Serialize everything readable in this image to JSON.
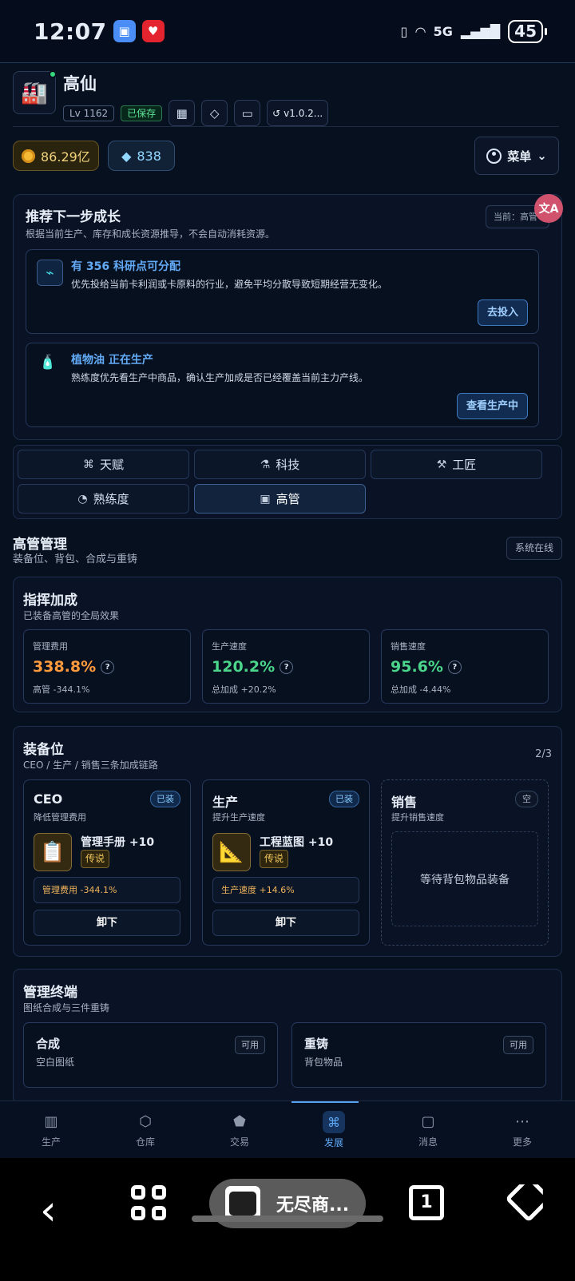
{
  "status": {
    "time": "12:07",
    "network": "5G",
    "battery": "45"
  },
  "profile": {
    "name": "高仙",
    "level": "Lv 1162",
    "saved": "已保存",
    "version": "v1.0.2...",
    "gold": "86.29亿",
    "gems": "838",
    "menu": "菜单",
    "icons": [
      "calendar-icon",
      "diamond-icon",
      "gamepad-icon",
      "history-icon"
    ]
  },
  "recommend": {
    "title": "推荐下一步成长",
    "subtitle": "根据当前生产、库存和成长资源推导，不会自动消耗资源。",
    "current": "当前：高管",
    "cards": [
      {
        "title": "有 356 科研点可分配",
        "desc": "优先投给当前卡利润或卡原料的行业，避免平均分散导致短期经营无变化。",
        "button": "去投入"
      },
      {
        "title": "植物油 正在生产",
        "desc": "熟练度优先看生产中商品，确认生产加成是否已经覆盖当前主力产线。",
        "button": "查看生产中"
      }
    ]
  },
  "tabs": [
    {
      "label": "天赋",
      "icon": "talent-icon"
    },
    {
      "label": "科技",
      "icon": "tech-icon"
    },
    {
      "label": "工匠",
      "icon": "hammer-icon"
    },
    {
      "label": "熟练度",
      "icon": "speed-icon"
    },
    {
      "label": "高管",
      "icon": "briefcase-icon"
    }
  ],
  "manage": {
    "title": "高管管理",
    "subtitle": "装备位、背包、合成与重铸",
    "status": "系统在线"
  },
  "command": {
    "title": "指挥加成",
    "subtitle": "已装备高管的全局效果",
    "stats": [
      {
        "label": "管理费用",
        "value": "338.8%",
        "help": "?",
        "note": "高管 -344.1%",
        "color": "#ff9a3d"
      },
      {
        "label": "生产速度",
        "value": "120.2%",
        "help": "?",
        "note": "总加成 +20.2%",
        "color": "#4ad58a"
      },
      {
        "label": "销售速度",
        "value": "95.6%",
        "help": "?",
        "note": "总加成 -4.44%",
        "color": "#4ad58a"
      }
    ]
  },
  "equipment": {
    "title": "装备位",
    "subtitle": "CEO / 生产 / 销售三条加成链路",
    "count": "2/3",
    "slots": [
      {
        "title": "CEO",
        "subtitle": "降低管理费用",
        "badge": "已装",
        "item": "管理手册 +10",
        "rarity": "传说",
        "bonus": "管理费用 -344.1%",
        "action": "卸下",
        "icon": "clipboard-icon"
      },
      {
        "title": "生产",
        "subtitle": "提升生产速度",
        "badge": "已装",
        "item": "工程蓝图 +10",
        "rarity": "传说",
        "bonus": "生产速度 +14.6%",
        "action": "卸下",
        "icon": "ruler-icon"
      },
      {
        "title": "销售",
        "subtitle": "提升销售速度",
        "badge": "空",
        "waiting": "等待背包物品装备"
      }
    ]
  },
  "terminal": {
    "title": "管理终端",
    "subtitle": "图纸合成与三件重铸",
    "panels": [
      {
        "title": "合成",
        "subtitle": "空白图纸",
        "status": "可用"
      },
      {
        "title": "重铸",
        "subtitle": "背包物品",
        "status": "可用"
      }
    ]
  },
  "bottom_nav": [
    {
      "label": "生产",
      "icon": "factory-icon"
    },
    {
      "label": "仓库",
      "icon": "box-icon"
    },
    {
      "label": "交易",
      "icon": "handshake-icon"
    },
    {
      "label": "发展",
      "icon": "growth-icon",
      "active": true
    },
    {
      "label": "消息",
      "icon": "message-icon"
    },
    {
      "label": "更多",
      "icon": "more-icon"
    }
  ],
  "system_nav": {
    "current_app": "无尽商...",
    "tab_count": "1"
  }
}
